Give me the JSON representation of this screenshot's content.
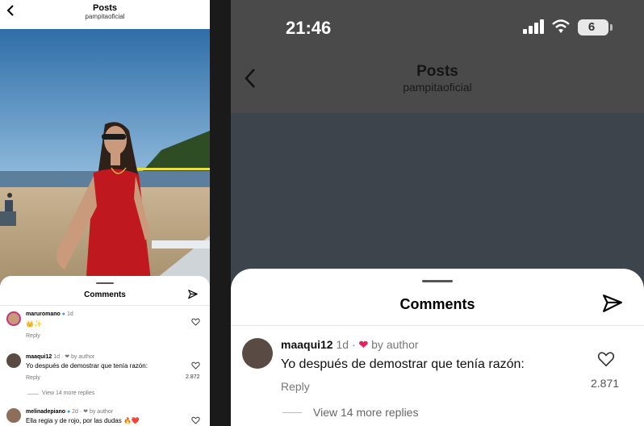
{
  "left_screen": {
    "header": {
      "title": "Posts",
      "subtitle": "pampitaoficial"
    },
    "sheet": {
      "title": "Comments"
    },
    "comments": [
      {
        "username": "maruromano",
        "meta": "1d",
        "text": "👑✨",
        "reply_label": "Reply",
        "likes": ""
      },
      {
        "username": "maaqui12",
        "meta": "1d · ❤ by author",
        "text": "Yo después de demostrar que tenía razón:",
        "reply_label": "Reply",
        "likes": "2.872",
        "more_replies": "View 14 more replies"
      },
      {
        "username": "melinadepiano",
        "meta": "2d · ❤ by author",
        "text": "Ella regia y de rojo, por las dudas 🔥❤️",
        "reply_label": "",
        "likes": ""
      }
    ]
  },
  "right_screen": {
    "status_bar": {
      "time": "21:46",
      "battery": "6"
    },
    "header": {
      "title": "Posts",
      "subtitle": "pampitaoficial"
    },
    "sheet": {
      "title": "Comments"
    },
    "comment": {
      "username": "maaqui12",
      "time": "1d",
      "author_badge": "by author",
      "text": "Yo después de demostrar que tenía razón:",
      "reply_label": "Reply",
      "likes": "2.871",
      "more_replies": "View 14 more replies"
    }
  },
  "colors": {
    "heart_red": "#e0245e",
    "verified_blue": "#3897f0",
    "muted_text": "#777777"
  }
}
